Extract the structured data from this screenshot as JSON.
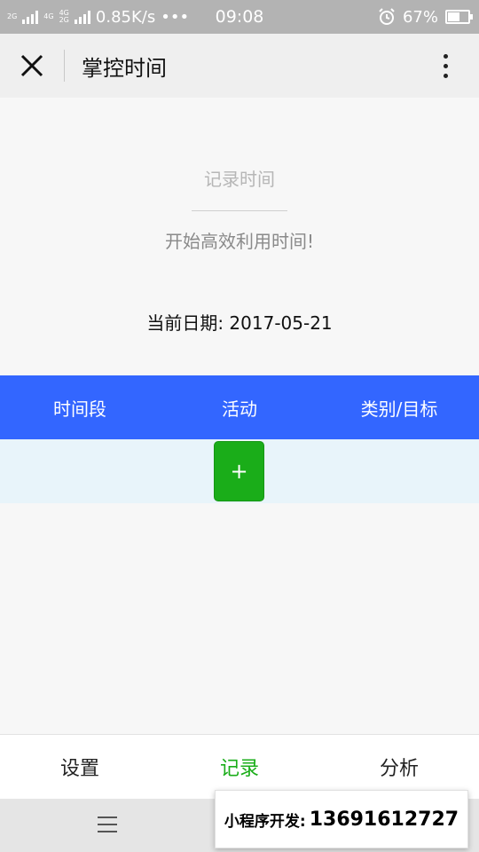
{
  "status_bar": {
    "network_speed": "0.85K/s",
    "dots": "•••",
    "time": "09:08",
    "battery": "67%",
    "battery_level": 0.67,
    "net_tag_1": "2G",
    "net_tag_2a": "4G",
    "net_tag_2b": "4G",
    "net_tag_2c": "2G"
  },
  "title_bar": {
    "title": "掌控时间"
  },
  "header": {
    "record_title": "记录时间",
    "subtitle": "开始高效利用时间!",
    "current_date": "当前日期: 2017-05-21"
  },
  "table": {
    "columns": [
      "时间段",
      "活动",
      "类别/目标"
    ],
    "add_label": "+"
  },
  "tabs": [
    {
      "label": "设置"
    },
    {
      "label": "记录"
    },
    {
      "label": "分析"
    }
  ],
  "active_tab_color": "#1aad19",
  "header_color": "#3366ff",
  "banner": {
    "label": "小程序开发:",
    "phone": "13691612727"
  }
}
